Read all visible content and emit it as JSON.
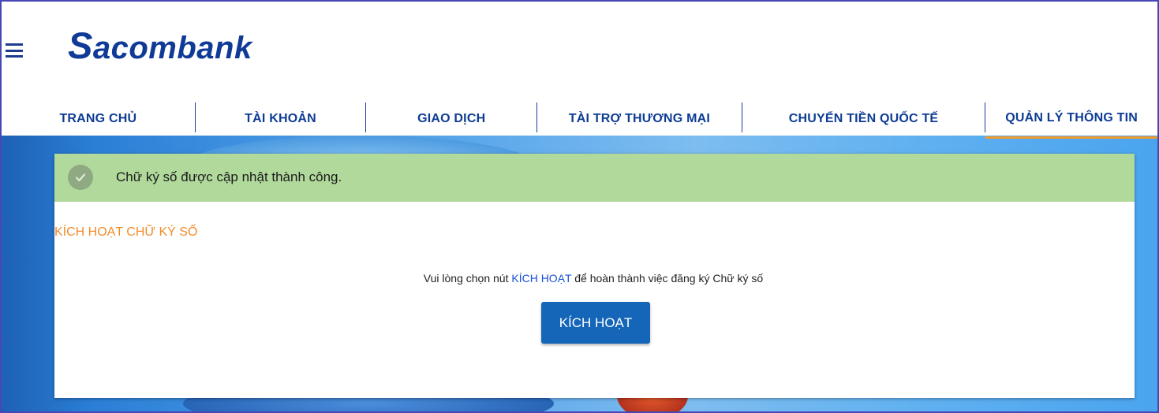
{
  "brand": {
    "logo_first": "S",
    "logo_rest": "acombank",
    "color": "#0f3a96"
  },
  "menu_icon": "hamburger-menu-icon",
  "nav": {
    "items": [
      {
        "label": "TRANG CHỦ",
        "active": false
      },
      {
        "label": "TÀI KHOẢN",
        "active": false
      },
      {
        "label": "GIAO DỊCH",
        "active": false
      },
      {
        "label": "TÀI TRỢ THƯƠNG MẠI",
        "active": false
      },
      {
        "label": "CHUYỂN TIỀN QUỐC TẾ",
        "active": false
      },
      {
        "label": "QUẢN LÝ THÔNG TIN",
        "active": true
      }
    ],
    "active_underline_color": "#f29b2f"
  },
  "alert": {
    "icon": "check-circle-icon",
    "message": "Chữ ký số được cập nhật thành công.",
    "background": "#b0d99b"
  },
  "section": {
    "title": "KÍCH HOẠT CHỮ KÝ SỐ",
    "title_color": "#f28b2a"
  },
  "instruction": {
    "before": "Vui lòng chọn nút ",
    "highlight": "KÍCH HOẠT",
    "after": " để hoàn thành việc đăng ký Chữ ký số"
  },
  "activate_button": {
    "label": "KÍCH HOẠT",
    "color": "#1566b8"
  }
}
